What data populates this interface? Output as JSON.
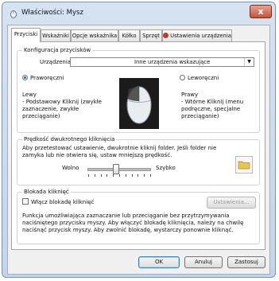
{
  "window": {
    "title": "Właściwości: Mysz",
    "close_label": "x"
  },
  "tabs": [
    {
      "label": "Przyciski",
      "active": true
    },
    {
      "label": "Wskaźniki"
    },
    {
      "label": "Opcje wskaźnika"
    },
    {
      "label": "Kółko"
    },
    {
      "label": "Sprzęt"
    },
    {
      "label": "Ustawienia urządzenia",
      "icon": "device-settings-icon"
    }
  ],
  "button_config": {
    "group_title": "Konfiguracja przycisków",
    "device_label": "Urządzenia:",
    "device_value": "Inne urządzenia wskazujące",
    "right_handed_label": "Praworęczni",
    "left_handed_label": "Leworęczni",
    "right_handed_selected": true,
    "left_heading": "Lewy",
    "left_description": "- Podstawowy Kliknij (zwykłe zaznaczenie, zwykłe przeciąganie)",
    "right_heading": "Prawy",
    "right_description": "- Wtórne Kliknij (menu podręczne, specjalne przeciąganie)"
  },
  "double_click": {
    "group_title": "Prędkość dwukrotnego kliknięcia",
    "description": "Aby przetestować ustawienie, dwukrotnie kliknij folder. Jeśli folder nie zamyka lub nie otwiera się, ustaw mniejszą prędkość.",
    "slow_label": "Wolno",
    "fast_label": "Szybko",
    "speed_level": 0.45
  },
  "click_lock": {
    "group_title": "Blokada kliknięć",
    "checkbox_label": "Włącz blokadę kliknięć",
    "checked": false,
    "settings_button": "Ustawienia...",
    "description": "Funkcja umożliwiająca zaznaczanie lub przeciąganie bez przytrzymywania naciśniętego przycisku myszy. Aby włączyć blokadę kliknięcia, należy na chwilę naciśnąć przycisk myszy. Aby zwolnić blokadę, wystarczy ponownie kliknąć."
  },
  "footer": {
    "ok": "OK",
    "cancel": "Anuluj",
    "apply": "Zastosuj"
  },
  "colors": {
    "accent": "#2a5db0",
    "folder": "#e9c74f"
  }
}
